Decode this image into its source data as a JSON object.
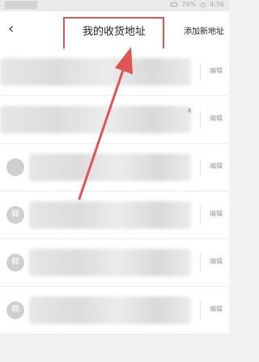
{
  "status_bar": {
    "battery": "79%",
    "time": "4:56"
  },
  "header": {
    "back_icon": "back-chevron-icon",
    "title": "我的收货地址",
    "add_label": "添加新地址"
  },
  "addresses": [
    {
      "avatar": "",
      "edit_label": "编辑"
    },
    {
      "avatar": "",
      "edit_label": "编辑"
    },
    {
      "avatar": "",
      "edit_label": "编辑"
    },
    {
      "avatar": "郭",
      "edit_label": "编辑"
    },
    {
      "avatar": "郭",
      "edit_label": "编辑"
    },
    {
      "avatar": "郭",
      "edit_label": "编辑"
    }
  ],
  "annotation": {
    "highlight_color": "#e05454"
  }
}
